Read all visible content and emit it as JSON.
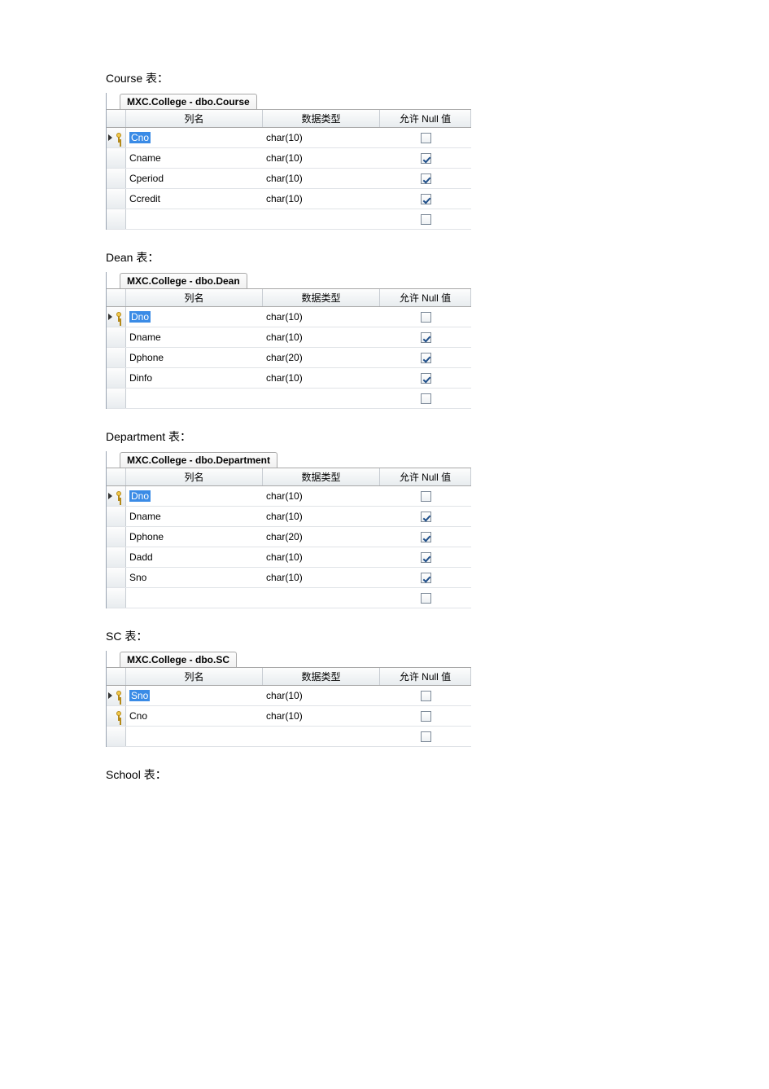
{
  "headers": {
    "col_name": "列名",
    "data_type": "数据类型",
    "allow_null": "允许 Null 值"
  },
  "tables": [
    {
      "caption": "Course 表：",
      "tab": "MXC.College - dbo.Course",
      "columns": [
        {
          "name": "Cno",
          "type": "char(10)",
          "null": false,
          "pk": true,
          "cursor": true,
          "selected": true
        },
        {
          "name": "Cname",
          "type": "char(10)",
          "null": true
        },
        {
          "name": "Cperiod",
          "type": "char(10)",
          "null": true
        },
        {
          "name": "Ccredit",
          "type": "char(10)",
          "null": true
        }
      ]
    },
    {
      "caption": "Dean 表：",
      "tab": "MXC.College - dbo.Dean",
      "columns": [
        {
          "name": "Dno",
          "type": "char(10)",
          "null": false,
          "pk": true,
          "cursor": true,
          "selected": true
        },
        {
          "name": "Dname",
          "type": "char(10)",
          "null": true
        },
        {
          "name": "Dphone",
          "type": "char(20)",
          "null": true
        },
        {
          "name": "Dinfo",
          "type": "char(10)",
          "null": true
        }
      ]
    },
    {
      "caption": "Department 表：",
      "tab": "MXC.College - dbo.Department",
      "columns": [
        {
          "name": "Dno",
          "type": "char(10)",
          "null": false,
          "pk": true,
          "cursor": true,
          "selected": true
        },
        {
          "name": "Dname",
          "type": "char(10)",
          "null": true
        },
        {
          "name": "Dphone",
          "type": "char(20)",
          "null": true
        },
        {
          "name": "Dadd",
          "type": "char(10)",
          "null": true
        },
        {
          "name": "Sno",
          "type": "char(10)",
          "null": true
        }
      ]
    },
    {
      "caption": "SC 表：",
      "tab": "MXC.College - dbo.SC",
      "columns": [
        {
          "name": "Sno",
          "type": "char(10)",
          "null": false,
          "pk": true,
          "cursor": true,
          "selected": true
        },
        {
          "name": "Cno",
          "type": "char(10)",
          "null": false,
          "pk": true
        }
      ]
    },
    {
      "caption": "School 表：",
      "tab": "",
      "columns": []
    }
  ]
}
